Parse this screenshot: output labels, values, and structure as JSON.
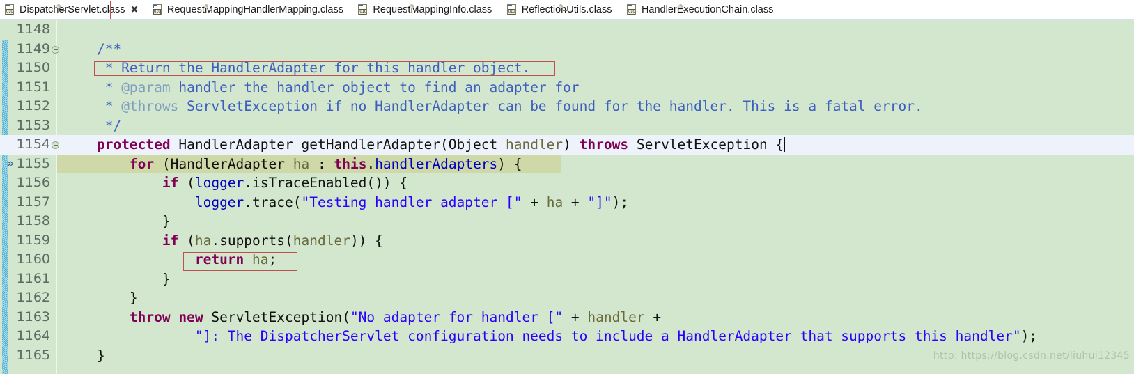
{
  "window": {
    "app": "Eclipse IDE",
    "editor_background": "#d2e7ce",
    "accent": "#c0504d"
  },
  "tabs": {
    "items": [
      {
        "label": "DispatcherServlet.class",
        "icon": "class-file-icon",
        "active": true,
        "close_glyph": "✖"
      },
      {
        "label": "RequestMappingHandlerMapping.class",
        "icon": "class-file-icon",
        "active": false
      },
      {
        "label": "RequestMappingInfo.class",
        "icon": "class-file-icon",
        "active": false
      },
      {
        "label": "ReflectionUtils.class",
        "icon": "class-file-icon",
        "active": false
      },
      {
        "label": "HandlerExecutionChain.class",
        "icon": "class-file-icon",
        "active": false
      }
    ]
  },
  "editor": {
    "caret_line": 1154,
    "occurrence_line": 1155,
    "breakpoint_marker_line": 1155,
    "fold_lines": [
      1149,
      1154
    ],
    "annotations": [
      {
        "name": "comment-highlight-box",
        "line": 1150,
        "color": "#c0504d"
      },
      {
        "name": "return-highlight-box",
        "line": 1160,
        "color": "#c0504d"
      },
      {
        "name": "active-tab-box",
        "target": "DispatcherServlet.class",
        "color": "#c0504d"
      }
    ],
    "lines": [
      {
        "no": "1148",
        "text": ""
      },
      {
        "no": "1149",
        "text": "    /**"
      },
      {
        "no": "1150",
        "text": "     * Return the HandlerAdapter for this handler object."
      },
      {
        "no": "1151",
        "text": "     * @param handler the handler object to find an adapter for"
      },
      {
        "no": "1152",
        "text": "     * @throws ServletException if no HandlerAdapter can be found for the handler. This is a fatal error."
      },
      {
        "no": "1153",
        "text": "     */"
      },
      {
        "no": "1154",
        "text": "    protected HandlerAdapter getHandlerAdapter(Object handler) throws ServletException {"
      },
      {
        "no": "1155",
        "text": "        for (HandlerAdapter ha : this.handlerAdapters) {"
      },
      {
        "no": "1156",
        "text": "            if (logger.isTraceEnabled()) {"
      },
      {
        "no": "1157",
        "text": "                logger.trace(\"Testing handler adapter [\" + ha + \"]\");"
      },
      {
        "no": "1158",
        "text": "            }"
      },
      {
        "no": "1159",
        "text": "            if (ha.supports(handler)) {"
      },
      {
        "no": "1160",
        "text": "                return ha;"
      },
      {
        "no": "1161",
        "text": "            }"
      },
      {
        "no": "1162",
        "text": "        }"
      },
      {
        "no": "1163",
        "text": "        throw new ServletException(\"No adapter for handler [\" + handler +"
      },
      {
        "no": "1164",
        "text": "                \"]: The DispatcherServlet configuration needs to include a HandlerAdapter that supports this handler\");"
      },
      {
        "no": "1165",
        "text": "    }"
      }
    ],
    "line_numbers": [
      "1148",
      "1149",
      "1150",
      "1151",
      "1152",
      "1153",
      "1154",
      "1155",
      "1156",
      "1157",
      "1158",
      "1159",
      "1160",
      "1161",
      "1162",
      "1163",
      "1164",
      "1165"
    ]
  },
  "watermark": {
    "text": "http: https://blog.csdn.net/liuhui12345"
  }
}
